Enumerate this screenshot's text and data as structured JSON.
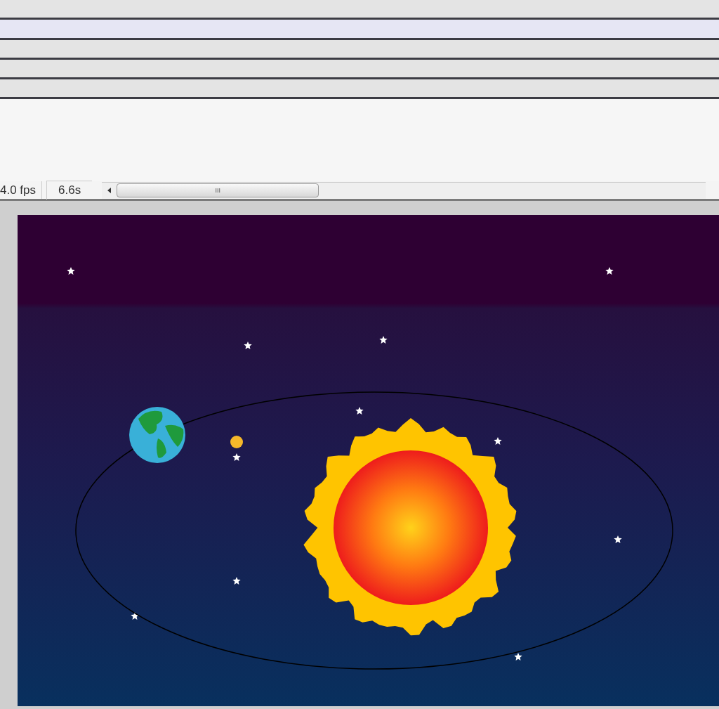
{
  "timeline": {
    "layers": [
      {
        "selected": false
      },
      {
        "selected": true
      },
      {
        "selected": false
      },
      {
        "selected": false
      },
      {
        "selected": false
      }
    ]
  },
  "status_bar": {
    "frame_rate": "4.0 fps",
    "elapsed_time": "6.6s",
    "scroll_grip": "III"
  }
}
